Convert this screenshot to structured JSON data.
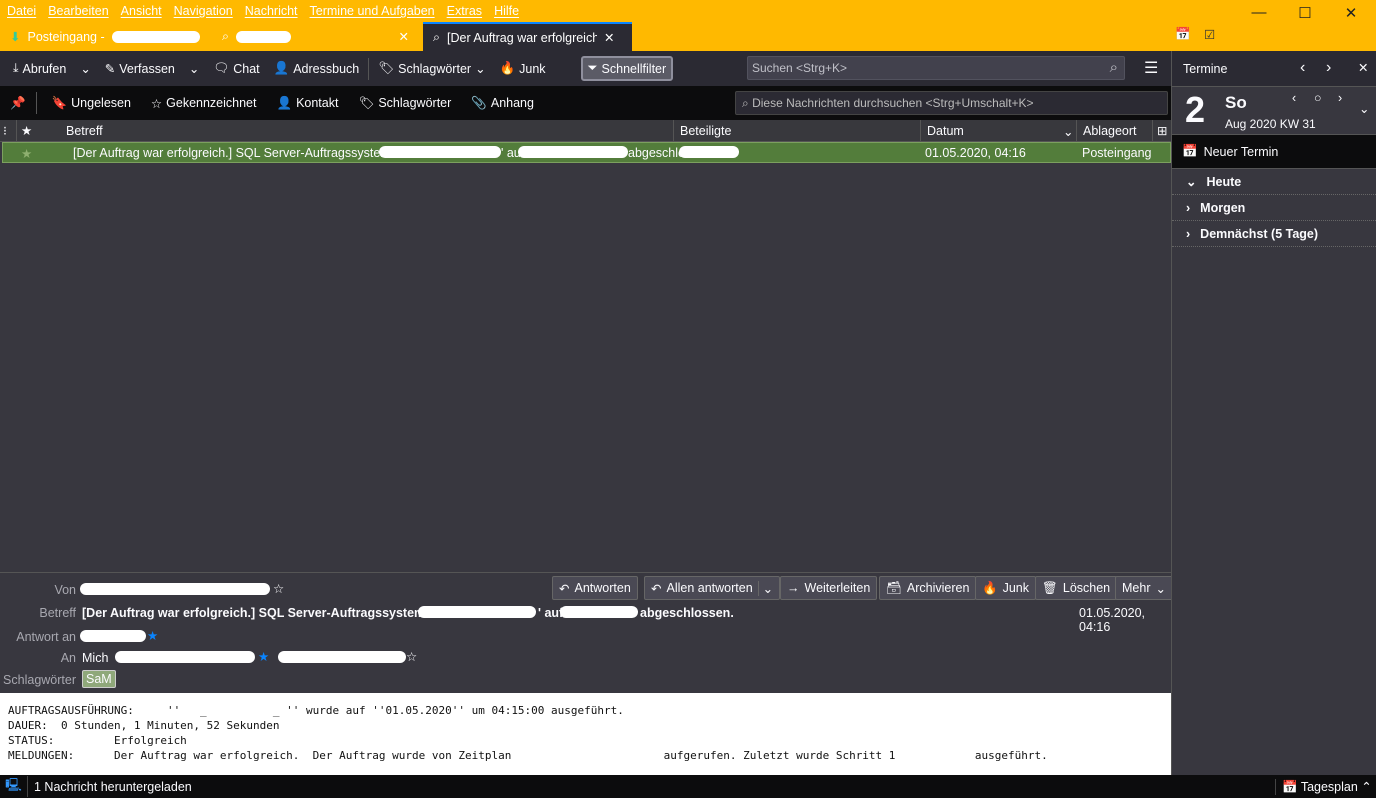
{
  "menu": [
    "Datei",
    "Bearbeiten",
    "Ansicht",
    "Navigation",
    "Nachricht",
    "Termine und Aufgaben",
    "Extras",
    "Hilfe"
  ],
  "tabs": [
    {
      "label": "Posteingang -"
    },
    {
      "label": ""
    },
    {
      "label": "[Der Auftrag war erfolgreich."
    }
  ],
  "toolbar": {
    "get": "Abrufen",
    "compose": "Verfassen",
    "chat": "Chat",
    "addressbook": "Adressbuch",
    "tags": "Schlagwörter",
    "junk": "Junk",
    "quickfilter": "Schnellfilter",
    "search_placeholder": "Suchen <Strg+K>"
  },
  "quickfilter": {
    "unread": "Ungelesen",
    "starred": "Gekennzeichnet",
    "contact": "Kontakt",
    "tags": "Schlagwörter",
    "attachment": "Anhang",
    "search_placeholder": "Diese Nachrichten durchsuchen <Strg+Umschalt+K>"
  },
  "columns": {
    "subject": "Betreff",
    "participants": "Beteiligte",
    "date": "Datum",
    "location": "Ablageort"
  },
  "messages": [
    {
      "subject_a": "[Der Auftrag war erfolgreich.] SQL Server-Auftragssystem:",
      "subject_b": "' au",
      "subject_c": "abgeschlo...",
      "date": "01.05.2020, 04:16",
      "location": "Posteingang"
    }
  ],
  "header": {
    "from_label": "Von",
    "subject_label": "Betreff",
    "reply_to_label": "Antwort an",
    "to_label": "An",
    "tags_label": "Schlagwörter",
    "subject_a": "[Der Auftrag war erfolgreich.] SQL Server-Auftragssystem: '",
    "subject_b": "' auf",
    "subject_c": "abgeschlossen.",
    "date": "01.05.2020, 04:16",
    "to_name": "Mich",
    "tag": "SaM",
    "buttons": {
      "reply": "Antworten",
      "reply_all": "Allen antworten",
      "forward": "Weiterleiten",
      "archive": "Archivieren",
      "junk": "Junk",
      "delete": "Löschen",
      "more": "Mehr"
    }
  },
  "body": [
    "AUFTRAGSAUSFÜHRUNG:     ''   _          _ '' wurde auf ''01.05.2020'' um 04:15:00 ausgeführt.",
    "DAUER:  0 Stunden, 1 Minuten, 52 Sekunden",
    "STATUS:         Erfolgreich",
    "MELDUNGEN:      Der Auftrag war erfolgreich.  Der Auftrag wurde von Zeitplan                       aufgerufen. Zuletzt wurde Schritt 1            ausgeführt."
  ],
  "status": {
    "text": "1 Nachricht heruntergeladen",
    "dayplan": "Tagesplan"
  },
  "calendar": {
    "title": "Termine",
    "day": "2",
    "weekday": "So",
    "monthyear": "Aug 2020  KW 31",
    "new_event": "Neuer Termin",
    "sections": [
      "Heute",
      "Morgen",
      "Demnächst (5 Tage)"
    ]
  }
}
